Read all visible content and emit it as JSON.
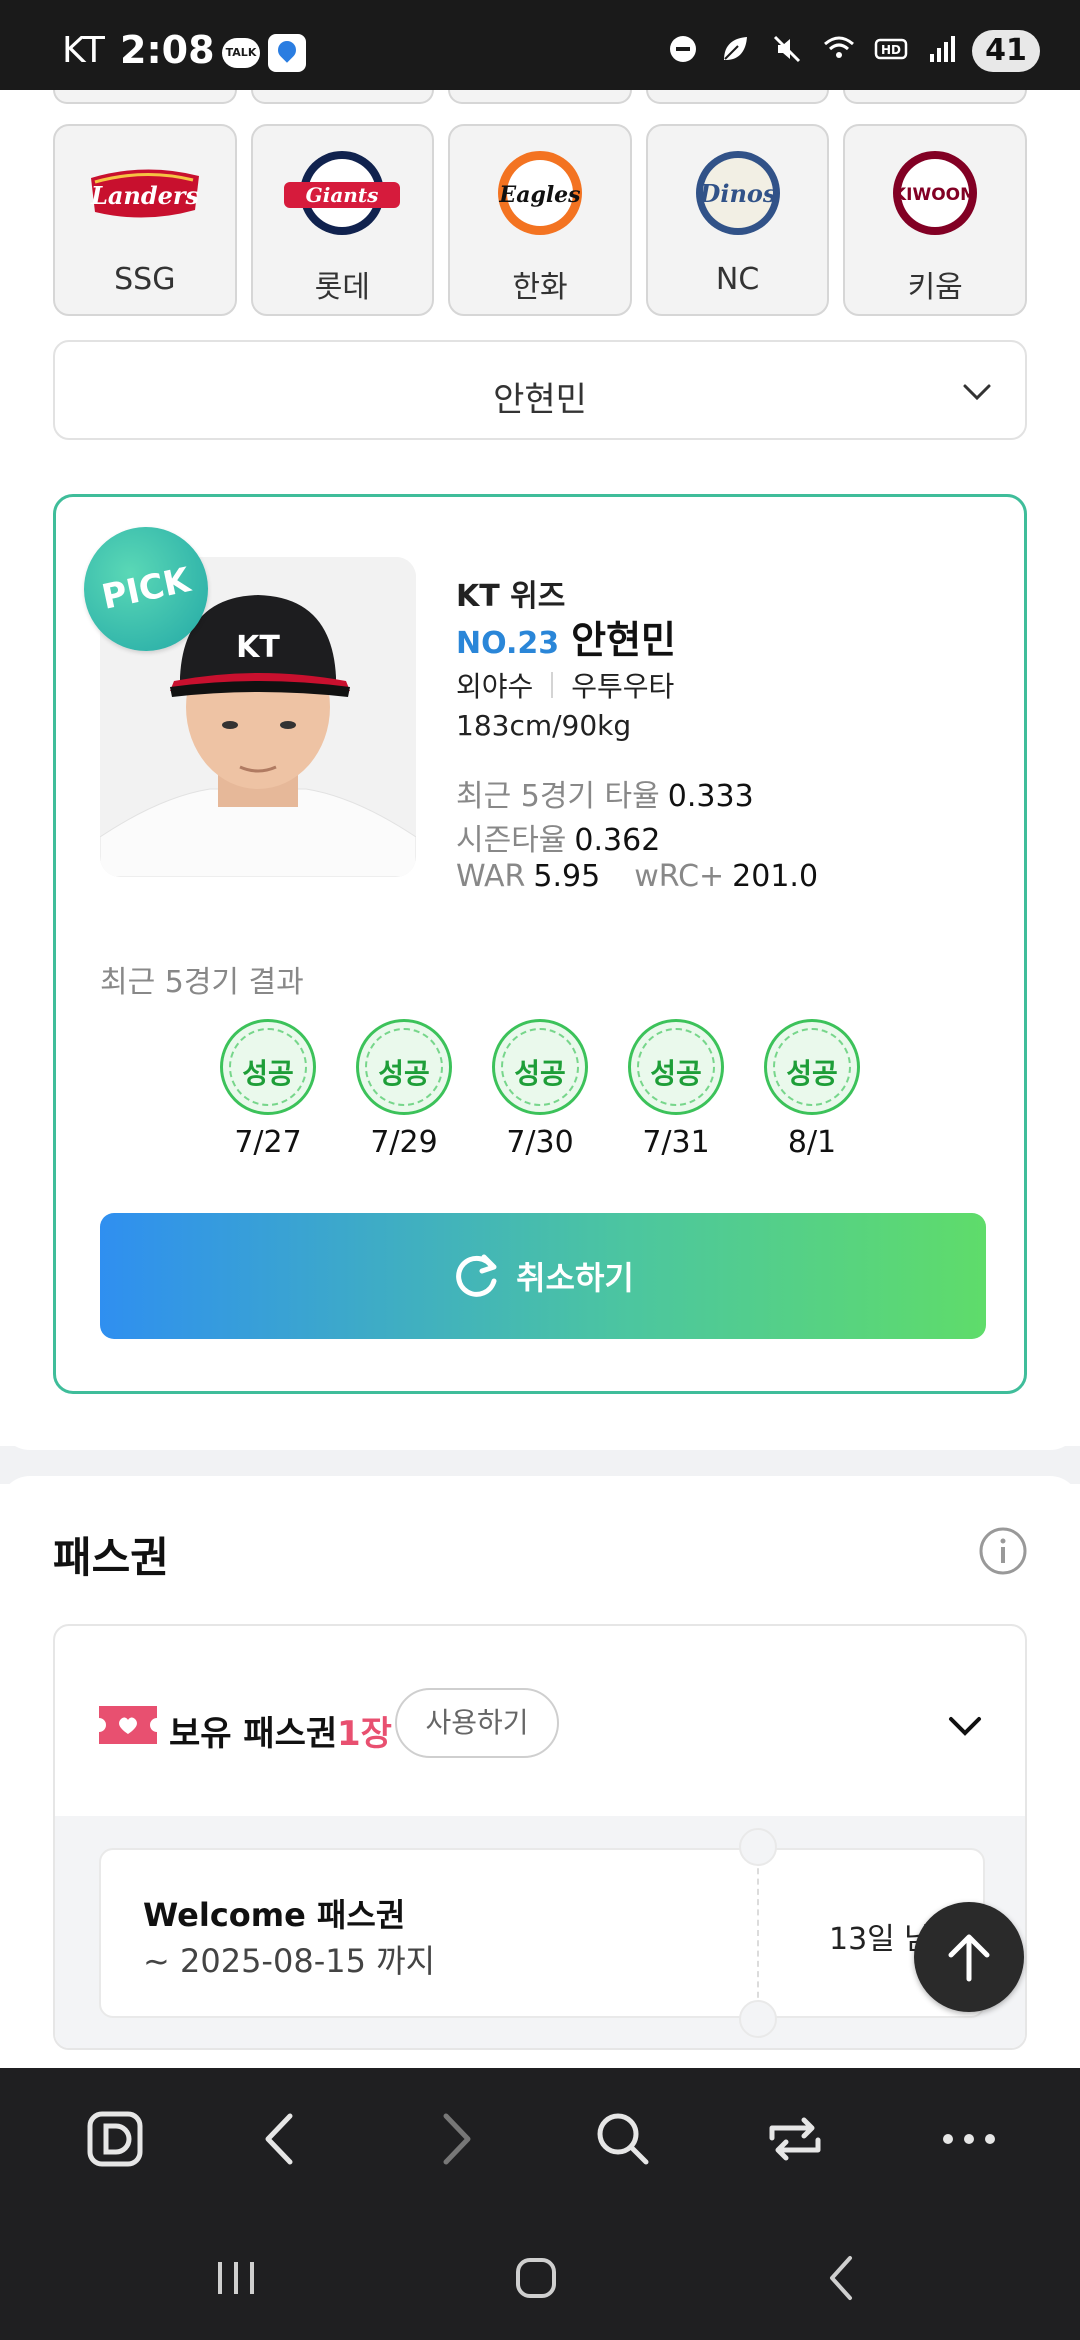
{
  "status_bar": {
    "carrier": "KT",
    "time": "2:08",
    "talk_label": "TALK",
    "battery": "41",
    "icons": [
      "talk-icon",
      "map-app-icon",
      "dnd-icon",
      "leaf-icon",
      "mute-icon",
      "wifi-icon",
      "hd-icon",
      "signal-icon"
    ]
  },
  "teams": [
    {
      "name": "SSG",
      "logo_text": "Landers",
      "color": "#c8102e"
    },
    {
      "name": "롯데",
      "logo_text": "Giants",
      "color": "#d61b3c"
    },
    {
      "name": "한화",
      "logo_text": "Eagles",
      "color": "#f37321"
    },
    {
      "name": "NC",
      "logo_text": "Dinos",
      "color": "#315288"
    },
    {
      "name": "키움",
      "logo_text": "KIWOOM",
      "color": "#820024"
    }
  ],
  "player_select": {
    "value": "안현민"
  },
  "pick_card": {
    "badge": "PICK",
    "team": "KT 위즈",
    "number": "NO.23",
    "name": "안현민",
    "position": "외야수",
    "bat_throw": "우투우타",
    "body": "183cm/90kg",
    "stats": {
      "recent5_label": "최근 5경기 타율",
      "recent5_value": "0.333",
      "season_label": "시즌타율",
      "season_value": "0.362",
      "war_label": "WAR",
      "war_value": "5.95",
      "wrc_label": "wRC+",
      "wrc_value": "201.0"
    },
    "recent_title": "최근 5경기 결과",
    "results": [
      {
        "label": "성공",
        "date": "7/27"
      },
      {
        "label": "성공",
        "date": "7/29"
      },
      {
        "label": "성공",
        "date": "7/30"
      },
      {
        "label": "성공",
        "date": "7/31"
      },
      {
        "label": "성공",
        "date": "8/1"
      }
    ],
    "cancel_label": "취소하기"
  },
  "pass": {
    "title": "패스권",
    "held_label": "보유 패스권",
    "held_count": "1장",
    "use_label": "사용하기",
    "ticket": {
      "name": "Welcome 패스권",
      "expiry": "~ 2025-08-15 까지",
      "remaining": "13일 남음"
    }
  },
  "colors": {
    "accent_blue": "#2a86d8",
    "success_green": "#1e9e38",
    "pass_pink": "#e85070",
    "card_border": "#3fbd9a"
  }
}
